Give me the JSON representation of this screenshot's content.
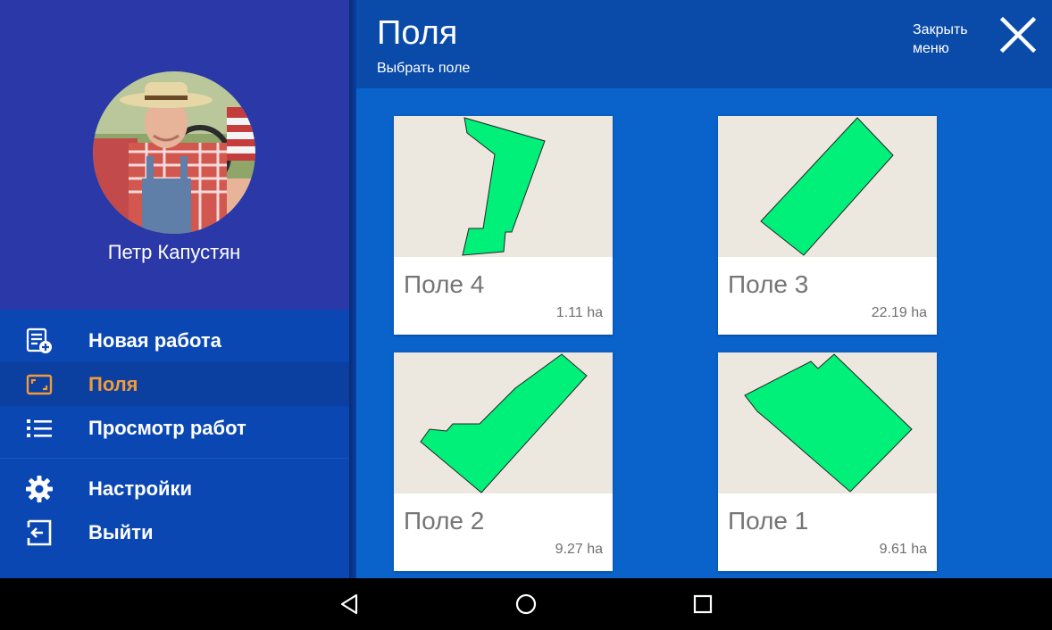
{
  "sidebar": {
    "user_name": "Петр Капустян",
    "items": [
      {
        "label": "Новая работа",
        "icon": "new-job-icon",
        "active": false
      },
      {
        "label": "Поля",
        "icon": "fields-icon",
        "active": true
      },
      {
        "label": "Просмотр работ",
        "icon": "list-icon",
        "active": false
      },
      {
        "label": "Настройки",
        "icon": "gear-icon",
        "active": false
      },
      {
        "label": "Выйти",
        "icon": "logout-icon",
        "active": false
      }
    ]
  },
  "header": {
    "title": "Поля",
    "subtitle": "Выбрать поле",
    "close_label": "Закрыть меню"
  },
  "fields": [
    {
      "name": "Поле 4",
      "area": "1.11 ha"
    },
    {
      "name": "Поле 3",
      "area": "22.19 ha"
    },
    {
      "name": "Поле 2",
      "area": "9.27 ha"
    },
    {
      "name": "Поле 1",
      "area": "9.61 ha"
    }
  ],
  "colors": {
    "accent": "#f39a3a",
    "field_fill": "#00f07a",
    "header_bg": "#0a4aa9",
    "main_bg": "#0a63cb",
    "sidebar_bg": "#0a47b3",
    "profile_bg": "#2a38a8"
  },
  "navbar": {
    "icons": [
      "back-icon",
      "home-icon",
      "recents-icon"
    ]
  }
}
